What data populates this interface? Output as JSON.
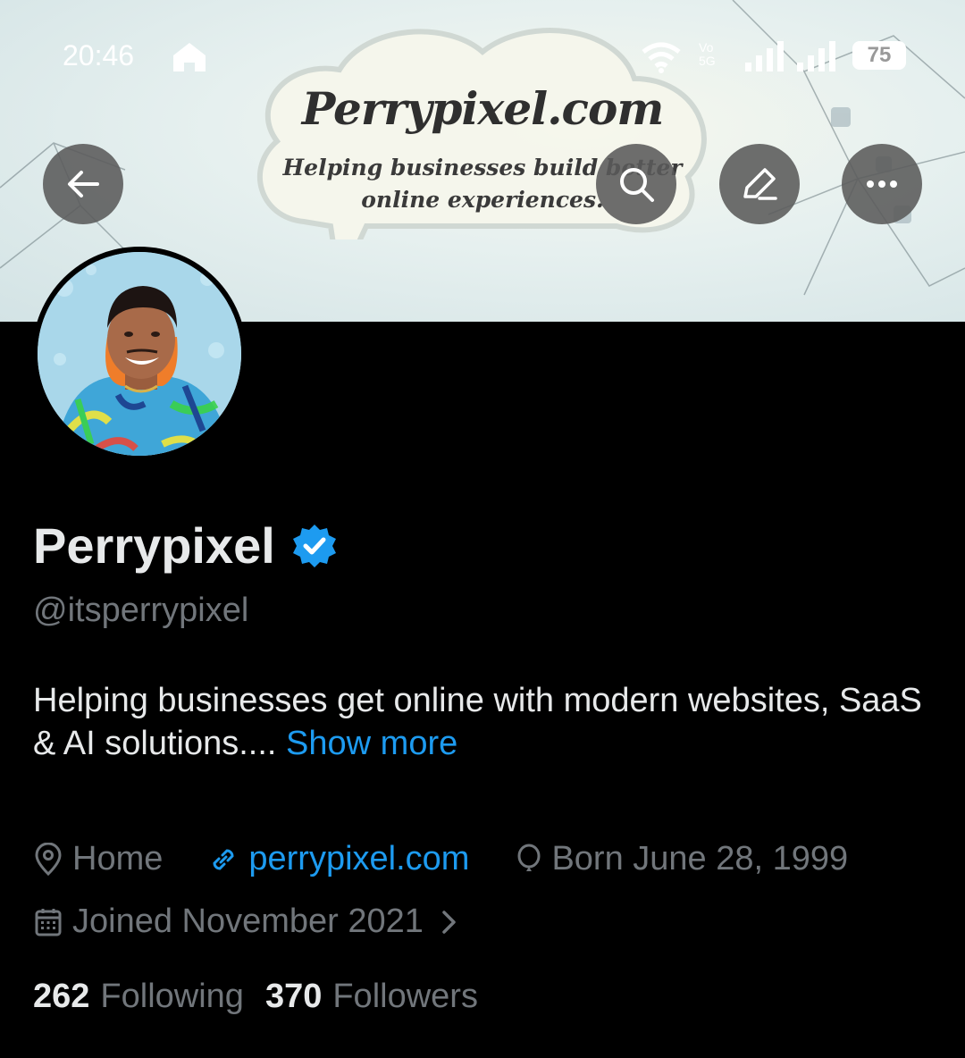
{
  "status_bar": {
    "time": "20:46",
    "network_label": "Vo 5G",
    "battery": "75"
  },
  "banner": {
    "brand_title": "Perrypixel.com",
    "brand_tagline": "Helping businesses build better online experiences."
  },
  "header_actions": {
    "back_icon": "arrow-left-icon",
    "search_icon": "search-icon",
    "edit_icon": "edit-icon",
    "more_icon": "more-icon"
  },
  "profile": {
    "name": "Perrypixel",
    "handle": "@itsperrypixel",
    "bio": "Helping businesses get online with modern websites, SaaS & AI solutions....",
    "show_more": "Show more",
    "location": "Home",
    "website": "perrypixel.com",
    "birthday": "Born June 28, 1999",
    "joined": "Joined November 2021",
    "following_count": "262",
    "following_label": "Following",
    "followers_count": "370",
    "followers_label": "Followers"
  },
  "colors": {
    "accent": "#1d9bf0",
    "muted": "#71767b",
    "text": "#e7e9ea",
    "background": "#000000"
  }
}
